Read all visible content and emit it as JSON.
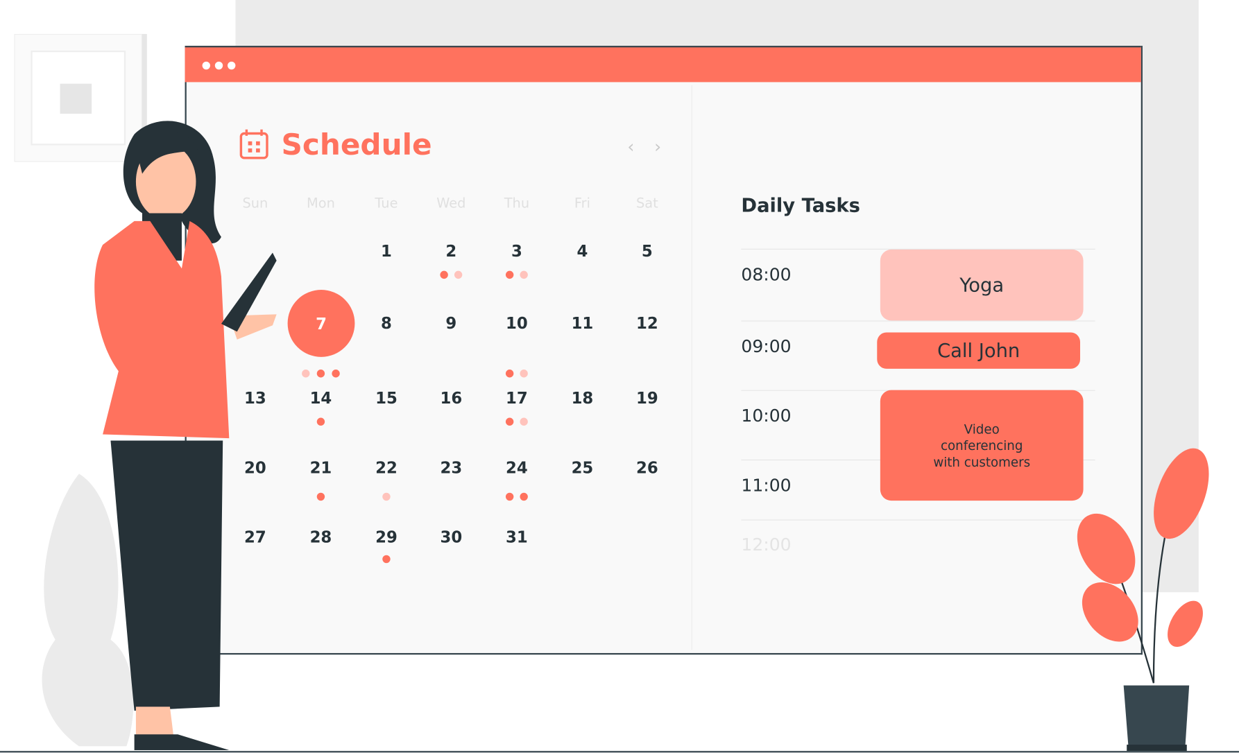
{
  "colors": {
    "accent": "#ff725e",
    "accent_light": "#ffc3bc",
    "dark": "#263238"
  },
  "calendar": {
    "title": "Schedule",
    "icon": "calendar-icon",
    "prev": "‹",
    "next": "›",
    "weekdays": [
      "Sun",
      "Mon",
      "Tue",
      "Wed",
      "Thu",
      "Fri",
      "Sat"
    ],
    "selected_day": "7",
    "weeks": [
      [
        null,
        null,
        {
          "d": "1"
        },
        {
          "d": "2",
          "dots": [
            "dark",
            "light"
          ]
        },
        {
          "d": "3",
          "dots": [
            "dark",
            "light"
          ]
        },
        {
          "d": "4"
        },
        {
          "d": "5"
        }
      ],
      [
        null,
        {
          "d": "7",
          "dots": [
            "light",
            "dark",
            "dark"
          ]
        },
        {
          "d": "8"
        },
        {
          "d": "9"
        },
        {
          "d": "10",
          "dots": [
            "dark",
            "light"
          ]
        },
        {
          "d": "11"
        },
        {
          "d": "12"
        }
      ],
      [
        {
          "d": "13"
        },
        {
          "d": "14",
          "dots": [
            "dark"
          ]
        },
        {
          "d": "15"
        },
        {
          "d": "16"
        },
        {
          "d": "17",
          "dots": [
            "dark",
            "light"
          ]
        },
        {
          "d": "18"
        },
        {
          "d": "19"
        }
      ],
      [
        {
          "d": "20"
        },
        {
          "d": "21",
          "dots": [
            "dark"
          ]
        },
        {
          "d": "22",
          "dots": [
            "light"
          ]
        },
        {
          "d": "23"
        },
        {
          "d": "24",
          "dots": [
            "dark",
            "dark"
          ]
        },
        {
          "d": "25"
        },
        {
          "d": "26"
        }
      ],
      [
        {
          "d": "27"
        },
        {
          "d": "28"
        },
        {
          "d": "29",
          "dots": [
            "dark"
          ]
        },
        {
          "d": "30"
        },
        {
          "d": "31"
        },
        null,
        null
      ]
    ]
  },
  "daily": {
    "title": "Daily Tasks",
    "times": [
      "08:00",
      "09:00",
      "10:00",
      "11:00",
      "12:00"
    ],
    "tasks": [
      {
        "label": "Yoga",
        "time": "08:00"
      },
      {
        "label": "Call John",
        "time": "09:00"
      },
      {
        "label": "Video conferencing with customers",
        "time": "10:00"
      }
    ]
  }
}
